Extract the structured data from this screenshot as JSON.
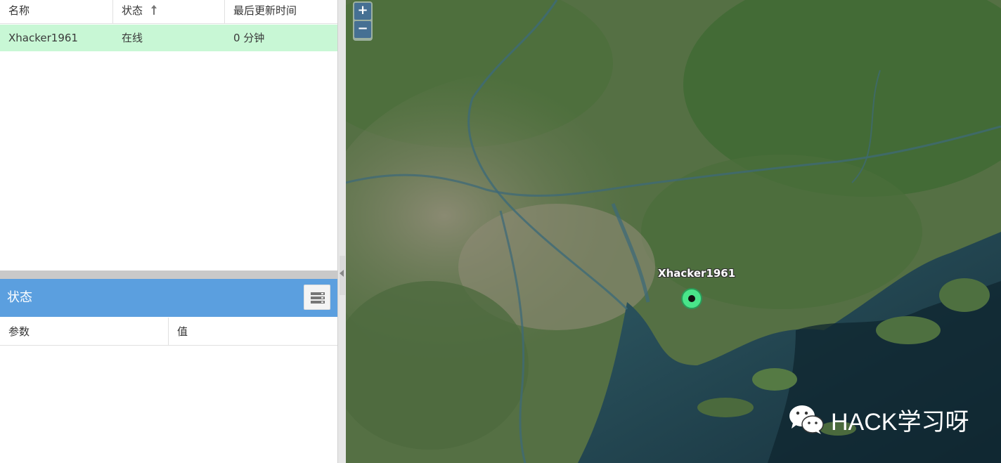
{
  "table": {
    "headers": [
      "名称",
      "状态",
      "最后更新时间"
    ],
    "rows": [
      {
        "name": "Xhacker1961",
        "status": "在线",
        "last_update": "0 分钟"
      }
    ]
  },
  "status_panel": {
    "title": "状态",
    "headers": [
      "参数",
      "值"
    ]
  },
  "map": {
    "zoom_in": "+",
    "zoom_out": "−",
    "marker_label": "Xhacker1961",
    "watermark": "HACK学习呀"
  },
  "colors": {
    "selected_row": "#c8f7d5",
    "panel_header": "#5b9fdf",
    "marker": "#49e58a"
  },
  "icons": {
    "sort": "arrow-up-icon",
    "panel_menu": "list-menu-icon",
    "watermark": "wechat-icon"
  }
}
